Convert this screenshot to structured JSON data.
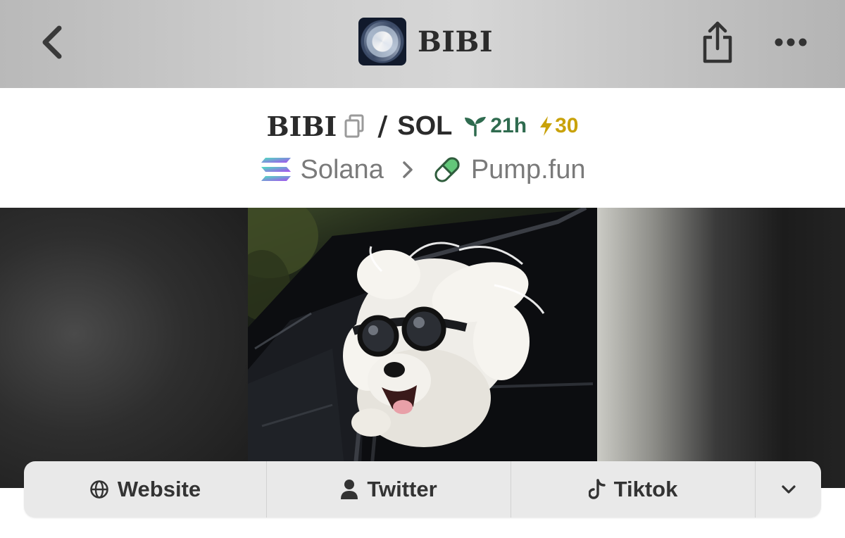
{
  "header": {
    "title": "BIBI",
    "icons": {
      "back": "chevron-left-icon",
      "share": "share-icon",
      "more": "ellipsis-icon"
    }
  },
  "pair": {
    "base": "BIBI",
    "separator": "/",
    "quote": "SOL",
    "age": "21h",
    "boosts": "30",
    "colors": {
      "age": "#2f6b4f",
      "boosts": "#c9a20a"
    }
  },
  "chain": {
    "network": "Solana",
    "dex": "Pump.fun"
  },
  "links": {
    "website": "Website",
    "twitter": "Twitter",
    "tiktok": "Tiktok"
  }
}
